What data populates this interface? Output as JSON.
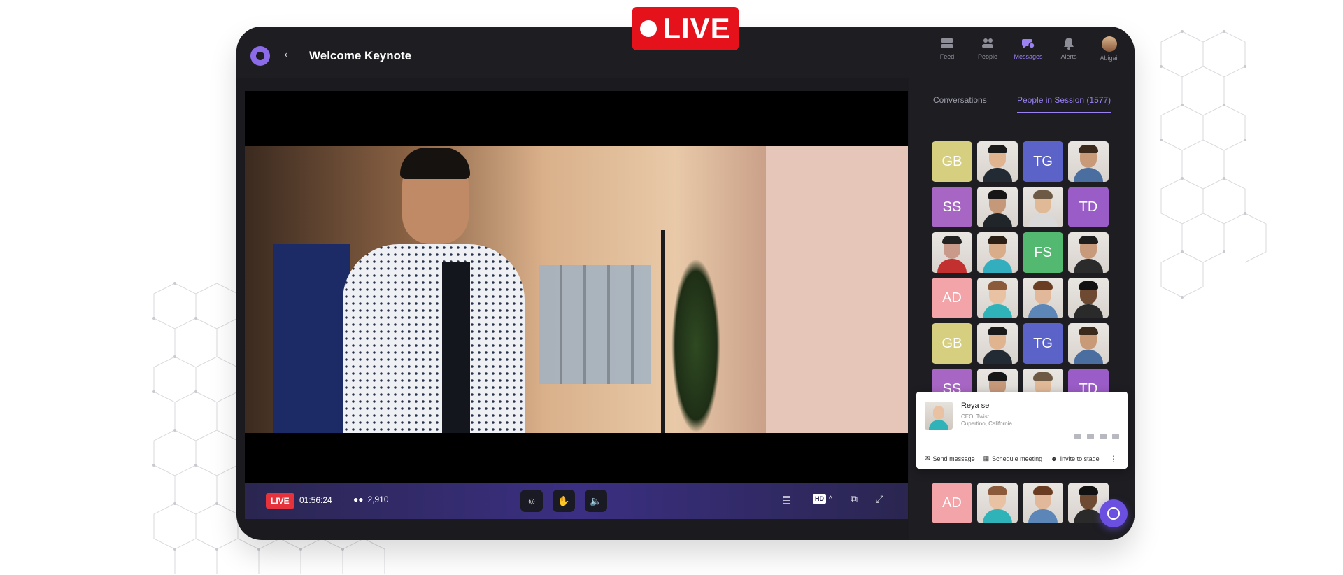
{
  "banner": {
    "live_label": "LIVE"
  },
  "header": {
    "title": "Welcome Keynote",
    "nav": [
      {
        "label": "Feed",
        "icon": "feed-icon",
        "active": false
      },
      {
        "label": "People",
        "icon": "people-icon",
        "active": false
      },
      {
        "label": "Messages",
        "icon": "messages-icon",
        "active": true
      },
      {
        "label": "Alerts",
        "icon": "bell-icon",
        "active": false
      },
      {
        "label": "Abigail",
        "icon": "user-avatar",
        "active": false
      }
    ]
  },
  "player": {
    "live_label": "LIVE",
    "elapsed": "01:56:24",
    "viewers": "2,910",
    "quality": "HD"
  },
  "sidebar": {
    "tabs": [
      {
        "label": "Conversations",
        "active": false
      },
      {
        "label": "People in Session (1577)",
        "active": true
      }
    ],
    "attendees": [
      {
        "initials": "GB",
        "color": "#d6cf80"
      },
      {
        "photo": true,
        "skin": "#e0b48f",
        "shirt": "#222a33",
        "hair": "#1a1a1a"
      },
      {
        "initials": "TG",
        "color": "#5b63c9"
      },
      {
        "photo": true,
        "skin": "#c99a78",
        "shirt": "#4a6ea0",
        "hair": "#3b2a1c"
      },
      {
        "initials": "SS",
        "color": "#a766c4"
      },
      {
        "photo": true,
        "skin": "#c6987a",
        "shirt": "#1f2529",
        "hair": "#161616"
      },
      {
        "photo": true,
        "skin": "#e0b997",
        "shirt": "#d9d9d9",
        "hair": "#6e5a44"
      },
      {
        "initials": "TD",
        "color": "#9a5cc6"
      },
      {
        "photo": true,
        "skin": "#c99a8a",
        "shirt": "#c23030",
        "hair": "#222"
      },
      {
        "photo": true,
        "skin": "#d9ac8a",
        "shirt": "#33aebf",
        "hair": "#2b1f16"
      },
      {
        "initials": "FS",
        "color": "#53b870"
      },
      {
        "photo": true,
        "skin": "#c79a7c",
        "shirt": "#2b2b2b",
        "hair": "#1d1d1d"
      },
      {
        "initials": "AD",
        "color": "#f2a4a8"
      },
      {
        "photo": true,
        "skin": "#e9c2a3",
        "shirt": "#2fb3b8",
        "hair": "#8a5a3a"
      },
      {
        "photo": true,
        "skin": "#e2b89b",
        "shirt": "#5c86b8",
        "hair": "#6a3d22"
      },
      {
        "photo": true,
        "skin": "#6e4a33",
        "shirt": "#2a2a2a",
        "hair": "#111"
      },
      {
        "initials": "GB",
        "color": "#d6cf80"
      },
      {
        "photo": true,
        "skin": "#e0b48f",
        "shirt": "#222a33",
        "hair": "#1a1a1a"
      },
      {
        "initials": "TG",
        "color": "#5b63c9"
      },
      {
        "photo": true,
        "skin": "#c99a78",
        "shirt": "#4a6ea0",
        "hair": "#3b2a1c"
      },
      {
        "initials": "SS",
        "color": "#a766c4"
      },
      {
        "photo": true,
        "skin": "#c6987a",
        "shirt": "#1f2529",
        "hair": "#161616"
      },
      {
        "photo": true,
        "skin": "#e0b997",
        "shirt": "#d9d9d9",
        "hair": "#6e5a44"
      },
      {
        "initials": "TD",
        "color": "#9a5cc6"
      }
    ],
    "bottom_row": [
      {
        "initials": "AD",
        "color": "#f2a4a8"
      },
      {
        "photo": true,
        "skin": "#e9c2a3",
        "shirt": "#2fb3b8",
        "hair": "#8a5a3a"
      },
      {
        "photo": true,
        "skin": "#e2b89b",
        "shirt": "#5c86b8",
        "hair": "#6a3d22"
      },
      {
        "photo": true,
        "skin": "#6e4a33",
        "shirt": "#2a2a2a",
        "hair": "#111"
      }
    ]
  },
  "profile_card": {
    "name": "Reya se",
    "role": "CEO, Twist",
    "location": "Cupertino, California",
    "actions": [
      "Send message",
      "Schedule meeting",
      "Invite to stage"
    ]
  },
  "colors": {
    "accent": "#9b82f2",
    "live_red": "#e5121b",
    "frame": "#1a1a1f"
  }
}
